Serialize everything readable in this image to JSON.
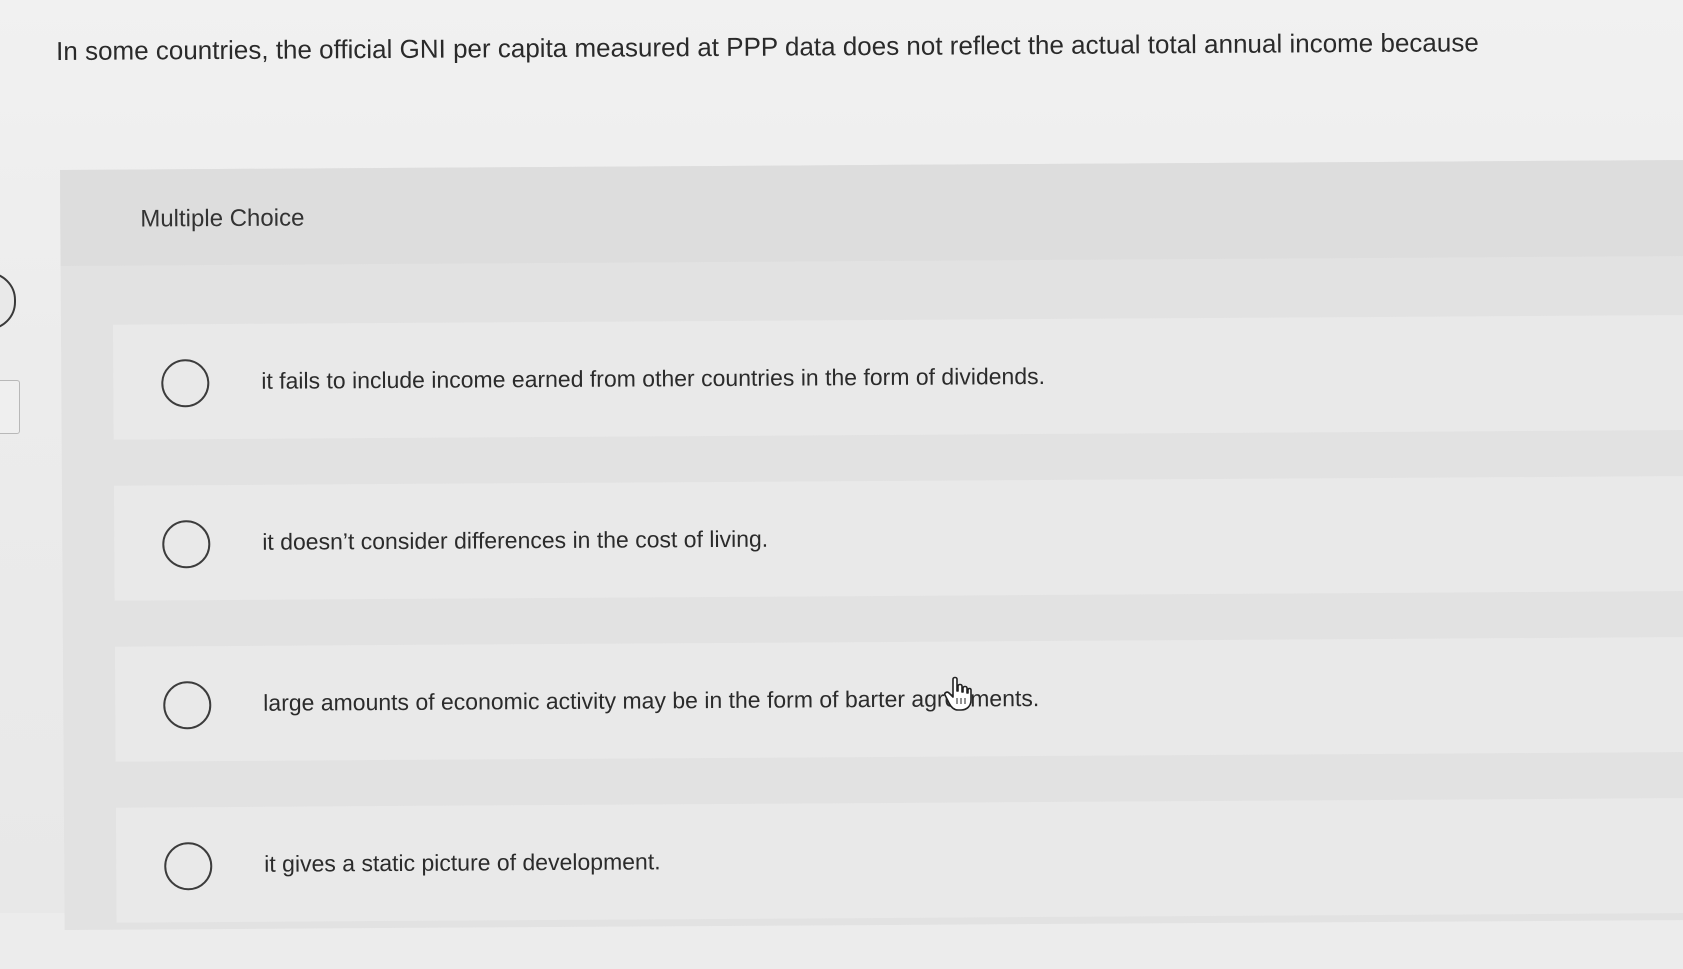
{
  "question": {
    "text": "In some countries, the official GNI per capita measured at PPP data does not reflect the actual total annual income because"
  },
  "multiple_choice": {
    "title": "Multiple Choice",
    "options": [
      {
        "label": "it fails to include income earned from other countries in the form of dividends."
      },
      {
        "label": "it doesn’t consider differences in the cost of living."
      },
      {
        "label": "large amounts of economic activity may be in the form of barter agreements."
      },
      {
        "label": "it gives a static picture of development."
      }
    ]
  },
  "icons": {
    "radio": "radio-button-unselected-icon",
    "cursor": "hand-pointer-icon"
  },
  "colors": {
    "background": "#ececec",
    "panel": "#e2e2e2",
    "text": "#2b2b2b"
  }
}
